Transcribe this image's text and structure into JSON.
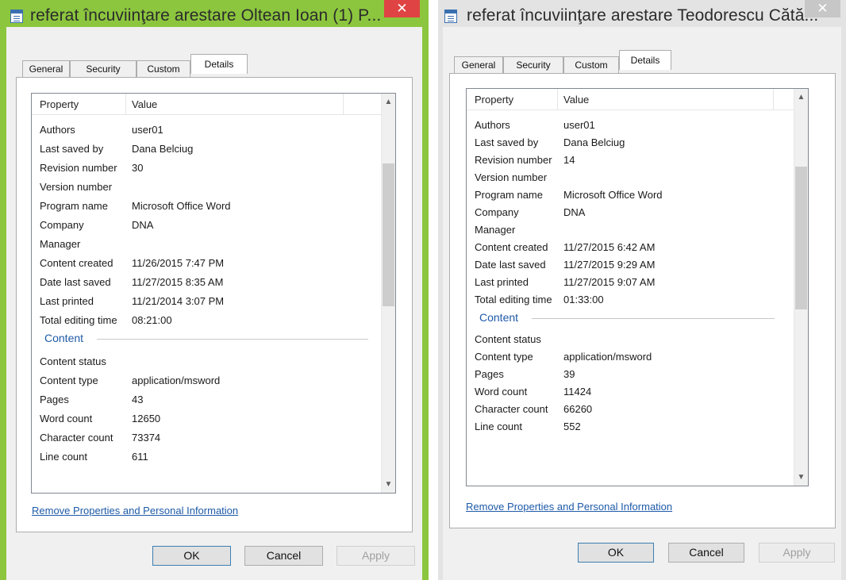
{
  "dialogs": [
    {
      "title": "referat încuviinţare arestare Oltean Ioan (1) P...",
      "close_glyph": "✕",
      "title_active": true,
      "tabs": [
        "General",
        "Security",
        "Custom",
        "Details"
      ],
      "active_tab": "Details",
      "columns": {
        "property": "Property",
        "value": "Value"
      },
      "rows_before": [
        {
          "k": "Authors",
          "v": "user01"
        },
        {
          "k": "Last saved by",
          "v": "Dana Belciug"
        },
        {
          "k": "Revision number",
          "v": "30"
        },
        {
          "k": "Version number",
          "v": ""
        },
        {
          "k": "Program name",
          "v": "Microsoft Office Word"
        },
        {
          "k": "Company",
          "v": "DNA"
        },
        {
          "k": "Manager",
          "v": ""
        },
        {
          "k": "Content created",
          "v": "11/26/2015 7:47 PM"
        },
        {
          "k": "Date last saved",
          "v": "11/27/2015 8:35 AM"
        },
        {
          "k": "Last printed",
          "v": "11/21/2014 3:07 PM"
        },
        {
          "k": "Total editing time",
          "v": "08:21:00"
        }
      ],
      "section": "Content",
      "rows_after": [
        {
          "k": "Content status",
          "v": ""
        },
        {
          "k": "Content type",
          "v": "application/msword"
        },
        {
          "k": "Pages",
          "v": "43"
        },
        {
          "k": "Word count",
          "v": "12650"
        },
        {
          "k": "Character count",
          "v": "73374"
        },
        {
          "k": "Line count",
          "v": "611"
        }
      ],
      "link": "Remove Properties and Personal Information",
      "buttons": {
        "ok": "OK",
        "cancel": "Cancel",
        "apply": "Apply"
      }
    },
    {
      "title": "referat încuviinţare arestare Teodorescu Cătă...",
      "close_glyph": "✕",
      "title_active": false,
      "tabs": [
        "General",
        "Security",
        "Custom",
        "Details"
      ],
      "active_tab": "Details",
      "columns": {
        "property": "Property",
        "value": "Value"
      },
      "rows_before": [
        {
          "k": "Authors",
          "v": "user01"
        },
        {
          "k": "Last saved by",
          "v": "Dana Belciug"
        },
        {
          "k": "Revision number",
          "v": "14"
        },
        {
          "k": "Version number",
          "v": ""
        },
        {
          "k": "Program name",
          "v": "Microsoft Office Word"
        },
        {
          "k": "Company",
          "v": "DNA"
        },
        {
          "k": "Manager",
          "v": ""
        },
        {
          "k": "Content created",
          "v": "11/27/2015 6:42 AM"
        },
        {
          "k": "Date last saved",
          "v": "11/27/2015 9:29 AM"
        },
        {
          "k": "Last printed",
          "v": "11/27/2015 9:07 AM"
        },
        {
          "k": "Total editing time",
          "v": "01:33:00"
        }
      ],
      "section": "Content",
      "rows_after": [
        {
          "k": "Content status",
          "v": ""
        },
        {
          "k": "Content type",
          "v": "application/msword"
        },
        {
          "k": "Pages",
          "v": "39"
        },
        {
          "k": "Word count",
          "v": "11424"
        },
        {
          "k": "Character count",
          "v": "66260"
        },
        {
          "k": "Line count",
          "v": "552"
        }
      ],
      "link": "Remove Properties and Personal Information",
      "buttons": {
        "ok": "OK",
        "cancel": "Cancel",
        "apply": "Apply"
      }
    }
  ],
  "colors": {
    "active_frame": "#8cc63e",
    "inactive_frame": "#e3e3e3",
    "close_active": "#e04343",
    "close_inactive": "#c7c7c7",
    "link": "#1e5aa8"
  }
}
